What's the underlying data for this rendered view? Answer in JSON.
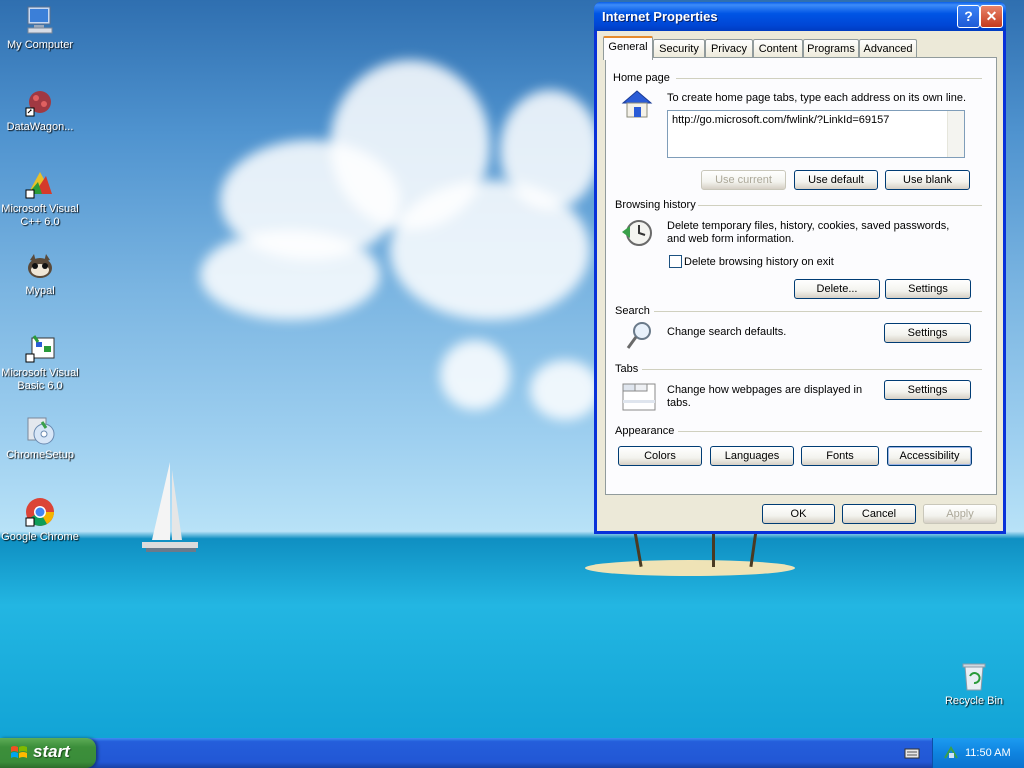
{
  "desktop": {
    "icons": [
      {
        "label": "My Computer"
      },
      {
        "label": "DataWagon..."
      },
      {
        "label": "Microsoft Visual C++ 6.0"
      },
      {
        "label": "Mypal"
      },
      {
        "label": "Microsoft Visual Basic 6.0"
      },
      {
        "label": "ChromeSetup"
      },
      {
        "label": "Google Chrome"
      },
      {
        "label": "Recycle Bin"
      }
    ]
  },
  "dialog": {
    "title": "Internet Properties",
    "help_symbol": "?",
    "close_symbol": "✕",
    "tabs": [
      {
        "label": "General",
        "active": true
      },
      {
        "label": "Security"
      },
      {
        "label": "Privacy"
      },
      {
        "label": "Content"
      },
      {
        "label": "Programs"
      },
      {
        "label": "Advanced"
      }
    ],
    "home_page": {
      "title": "Home page",
      "description": "To create home page tabs, type each address on its own line.",
      "url": "http://go.microsoft.com/fwlink/?LinkId=69157",
      "use_current": "Use current",
      "use_default": "Use default",
      "use_blank": "Use blank"
    },
    "browsing_history": {
      "title": "Browsing history",
      "description": "Delete temporary files, history, cookies, saved passwords, and web form information.",
      "checkbox_label": "Delete browsing history on exit",
      "checkbox_checked": false,
      "delete_btn": "Delete...",
      "settings_btn": "Settings"
    },
    "search": {
      "title": "Search",
      "description": "Change search defaults.",
      "settings_btn": "Settings"
    },
    "tabs_section": {
      "title": "Tabs",
      "description": "Change how webpages are displayed in tabs.",
      "settings_btn": "Settings"
    },
    "appearance": {
      "title": "Appearance",
      "colors": "Colors",
      "languages": "Languages",
      "fonts": "Fonts",
      "accessibility": "Accessibility"
    },
    "footer": {
      "ok": "OK",
      "cancel": "Cancel",
      "apply": "Apply"
    }
  },
  "taskbar": {
    "start_label": "start",
    "clock": "11:50 AM"
  }
}
